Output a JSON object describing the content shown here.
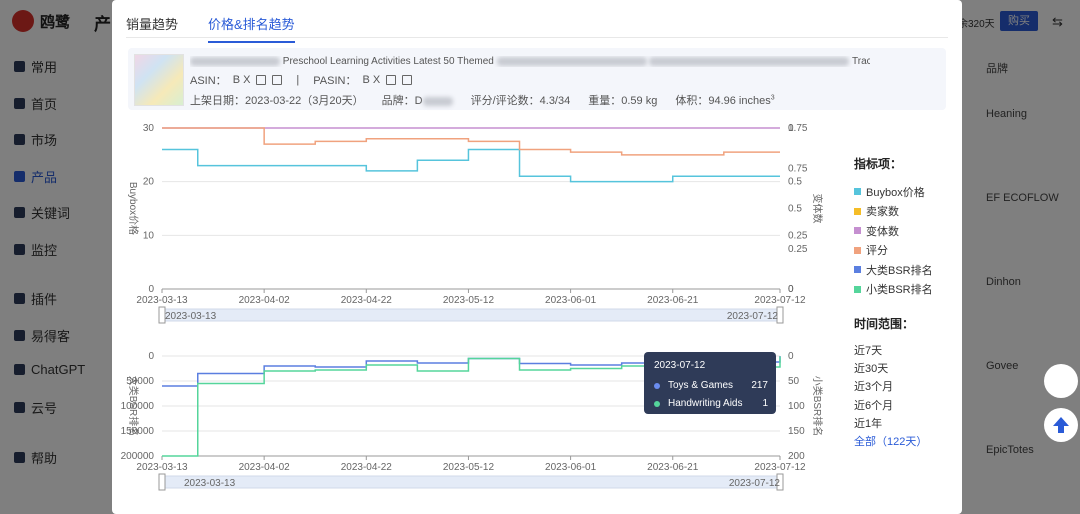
{
  "app": {
    "name": "鸥鹭",
    "nav_items": [
      {
        "label": "常用",
        "icon": "star-icon"
      },
      {
        "label": "首页",
        "icon": "home-icon"
      },
      {
        "label": "市场",
        "icon": "grid-icon"
      },
      {
        "label": "产品",
        "icon": "eye-icon",
        "active": true
      },
      {
        "label": "关键词",
        "icon": "bar-chart-icon"
      },
      {
        "label": "监控",
        "icon": "monitor-icon"
      },
      {
        "label": "插件",
        "icon": "plugin-icon"
      },
      {
        "label": "易得客",
        "icon": "rocket-icon"
      },
      {
        "label": "ChatGPT",
        "icon": "chatgpt-icon"
      },
      {
        "label": "云号",
        "icon": "cloud-icon"
      },
      {
        "label": "帮助",
        "icon": "help-icon"
      }
    ],
    "header_partial": "产",
    "days_left": "余320天",
    "buy_label": "购买",
    "brand_column_header": "品牌",
    "brand_values": [
      "Heaning",
      "EF ECOFLOW",
      "Dinhon",
      "Govee",
      "EpicTotes"
    ]
  },
  "modal": {
    "tabs": [
      {
        "label": "销量趋势",
        "active": false
      },
      {
        "label": "价格&排名趋势",
        "active": true
      }
    ],
    "product": {
      "title_visible_start": "Preschool Learning Activities Latest 50 Themed",
      "title_visible_end": "Trac...",
      "asin_label": "ASIN：",
      "asin_value_visible": "B          X",
      "pasin_label": "PASIN：",
      "pasin_value_visible": "B          X",
      "separator": "|",
      "listed_label": "上架日期：",
      "listed_value": "2023-03-22（3月20天）",
      "brand_label": "品牌：",
      "brand_value_visible": "D",
      "rating_label": "评分/评论数：",
      "rating_value": "4.3/34",
      "weight_label": "重量：",
      "weight_value": "0.59 kg",
      "volume_label": "体积：",
      "volume_value": "94.96 inches",
      "volume_sup": "3"
    },
    "indicators_title": "指标项：",
    "indicators": [
      {
        "label": "Buybox价格",
        "color": "#56c4dc"
      },
      {
        "label": "卖家数",
        "color": "#f5bd27"
      },
      {
        "label": "变体数",
        "color": "#c58fd0"
      },
      {
        "label": "评分",
        "color": "#f0a27e"
      },
      {
        "label": "大类BSR排名",
        "color": "#5b7fe0"
      },
      {
        "label": "小类BSR排名",
        "color": "#55d59b"
      }
    ],
    "range_title": "时间范围：",
    "ranges": [
      {
        "label": "近7天"
      },
      {
        "label": "近30天"
      },
      {
        "label": "近3个月"
      },
      {
        "label": "近6个月"
      },
      {
        "label": "近1年"
      },
      {
        "label": "全部（122天）",
        "active": true
      }
    ],
    "tooltip": {
      "date": "2023-07-12",
      "rows": [
        {
          "label": "Toys & Games",
          "value": "217",
          "color": "#6b8df0"
        },
        {
          "label": "Handwriting Aids",
          "value": "1",
          "color": "#55d59b"
        }
      ]
    },
    "slider_start": "2023-03-13",
    "slider_end": "2023-07-12"
  },
  "chart_data": [
    {
      "type": "line",
      "title": "",
      "x": [
        "2023-03-13",
        "2023-03-20",
        "2023-04-02",
        "2023-04-12",
        "2023-04-22",
        "2023-05-02",
        "2023-05-12",
        "2023-05-22",
        "2023-06-01",
        "2023-06-11",
        "2023-06-21",
        "2023-07-01",
        "2023-07-12"
      ],
      "xticks": [
        "2023-03-13",
        "2023-04-02",
        "2023-04-22",
        "2023-05-12",
        "2023-06-01",
        "2023-06-21",
        "2023-07-12"
      ],
      "ylabel": "Buybox价格",
      "y2label": "变体数",
      "ylim": [
        0,
        30
      ],
      "y2lim": [
        0,
        1
      ],
      "yticks": [
        0,
        10,
        20,
        30
      ],
      "y2ticks": [
        "0",
        "0.25",
        "0.5",
        "0.75",
        "1"
      ],
      "series": [
        {
          "name": "Buybox价格",
          "axis": "left",
          "color": "#56c4dc",
          "values": [
            26,
            23,
            23,
            23,
            22,
            24,
            26,
            21,
            20,
            20,
            21,
            21,
            21
          ]
        },
        {
          "name": "变体数",
          "axis": "left",
          "color": "#c58fd0",
          "values": [
            30,
            30,
            30,
            30,
            30,
            30,
            30,
            30,
            30,
            30,
            30,
            30,
            30
          ]
        },
        {
          "name": "评分",
          "axis": "left",
          "color": "#f0a27e",
          "values": [
            30,
            30,
            27,
            27.5,
            28,
            28,
            27.5,
            26,
            25.5,
            25,
            25,
            25.5,
            25.5
          ]
        }
      ]
    },
    {
      "type": "line",
      "title": "",
      "x": [
        "2023-03-13",
        "2023-03-20",
        "2023-04-02",
        "2023-04-12",
        "2023-04-22",
        "2023-05-02",
        "2023-05-12",
        "2023-05-22",
        "2023-06-01",
        "2023-06-11",
        "2023-06-21",
        "2023-07-01",
        "2023-07-12"
      ],
      "xticks": [
        "2023-03-13",
        "2023-04-02",
        "2023-04-22",
        "2023-05-12",
        "2023-06-01",
        "2023-06-21",
        "2023-07-12"
      ],
      "ylabel": "大类BSR排名",
      "y2label": "小类BSR排名",
      "ylim": [
        200000,
        0
      ],
      "y2lim": [
        200,
        0
      ],
      "yticks": [
        "0",
        "50000",
        "100000",
        "150000",
        "200000"
      ],
      "y2ticks": [
        "0",
        "50",
        "100",
        "150",
        "200"
      ],
      "series": [
        {
          "name": "大类BSR排名",
          "axis": "left",
          "color": "#5b7fe0",
          "values": [
            60000,
            35000,
            20000,
            22000,
            10000,
            14000,
            5000,
            15000,
            18000,
            14000,
            20000,
            12000,
            217
          ]
        },
        {
          "name": "小类BSR排名",
          "axis": "right",
          "color": "#55d59b",
          "values": [
            200,
            55,
            30,
            28,
            18,
            30,
            5,
            28,
            25,
            20,
            28,
            22,
            1
          ]
        }
      ]
    }
  ]
}
